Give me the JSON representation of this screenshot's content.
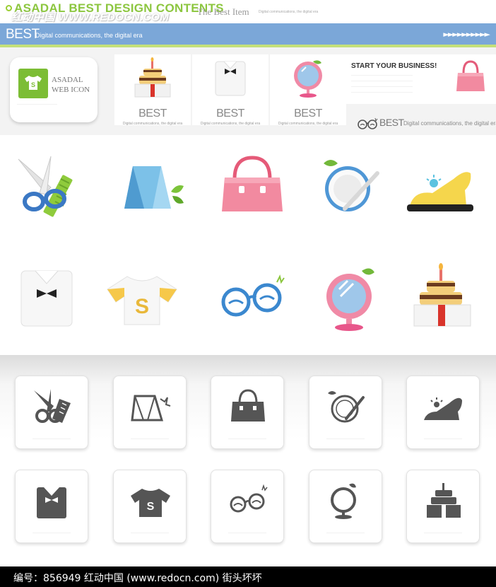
{
  "header": {
    "title": "ASADAL BEST DESIGN CONTENTS",
    "watermark": "红动中国 WWW.REDOCN.COM",
    "best_item": "The Best Item",
    "tagline": "Digital communications, the digital era"
  },
  "banner": {
    "best": "BEST",
    "tagline": "Digital communications, the digital era",
    "arrows": "►►►►►►►►►►",
    "color": "#7ba7d8"
  },
  "preview_strip": {
    "asadal_card": {
      "label_line1": "ASADAL",
      "label_line2": "WEB ICON",
      "icon_letter": "S",
      "accent": "#7cbd35"
    },
    "best_cards": [
      {
        "icon": "cake-icon",
        "word": "BEST",
        "tagline": "Digital communications, the digital era"
      },
      {
        "icon": "shirt-bowtie-icon",
        "word": "BEST",
        "tagline": "Digital communications, the digital era"
      },
      {
        "icon": "mirror-icon",
        "word": "BEST",
        "tagline": "Digital communications, the digital era"
      }
    ],
    "business_card": {
      "title": "START YOUR BUSINESS!",
      "icon": "handbag-icon"
    },
    "best_line": {
      "icon": "glasses-icon",
      "word": "BEST",
      "tagline": "Digital communications, the digital era"
    }
  },
  "colored_icons": [
    {
      "name": "scissors-comb-icon"
    },
    {
      "name": "diamond-icon"
    },
    {
      "name": "handbag-icon"
    },
    {
      "name": "plate-icon"
    },
    {
      "name": "high-heel-icon"
    },
    {
      "name": "shirt-bowtie-icon"
    },
    {
      "name": "tshirt-icon",
      "letter": "S"
    },
    {
      "name": "glasses-icon"
    },
    {
      "name": "mirror-icon"
    },
    {
      "name": "cake-icon"
    }
  ],
  "mono_icons": [
    {
      "name": "scissors-comb-icon"
    },
    {
      "name": "diamond-icon"
    },
    {
      "name": "handbag-icon"
    },
    {
      "name": "plate-icon"
    },
    {
      "name": "high-heel-icon"
    },
    {
      "name": "shirt-bowtie-icon"
    },
    {
      "name": "tshirt-icon",
      "letter": "S"
    },
    {
      "name": "glasses-icon"
    },
    {
      "name": "mirror-icon"
    },
    {
      "name": "cake-icon"
    }
  ],
  "footer": {
    "text": "编号：856949    红动中国 (www.redocn.com)    街头坏坏"
  }
}
